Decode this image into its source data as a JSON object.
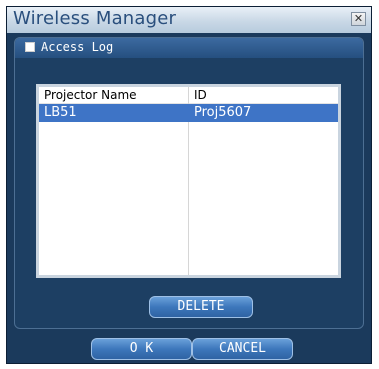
{
  "window": {
    "title": "Wireless Manager",
    "close_glyph": "✕"
  },
  "panel": {
    "title": "Access Log",
    "checkbox_checked": false
  },
  "table": {
    "columns": [
      "Projector Name",
      "ID"
    ],
    "rows": [
      {
        "name": "LB51",
        "id": "Proj5607",
        "selected": true
      }
    ]
  },
  "buttons": {
    "delete": "DELETE",
    "ok": "O K",
    "cancel": "CANCEL"
  },
  "colors": {
    "window_bg": "#1b3a5c",
    "selection": "#3e74c6",
    "button": "#3d77bb"
  }
}
